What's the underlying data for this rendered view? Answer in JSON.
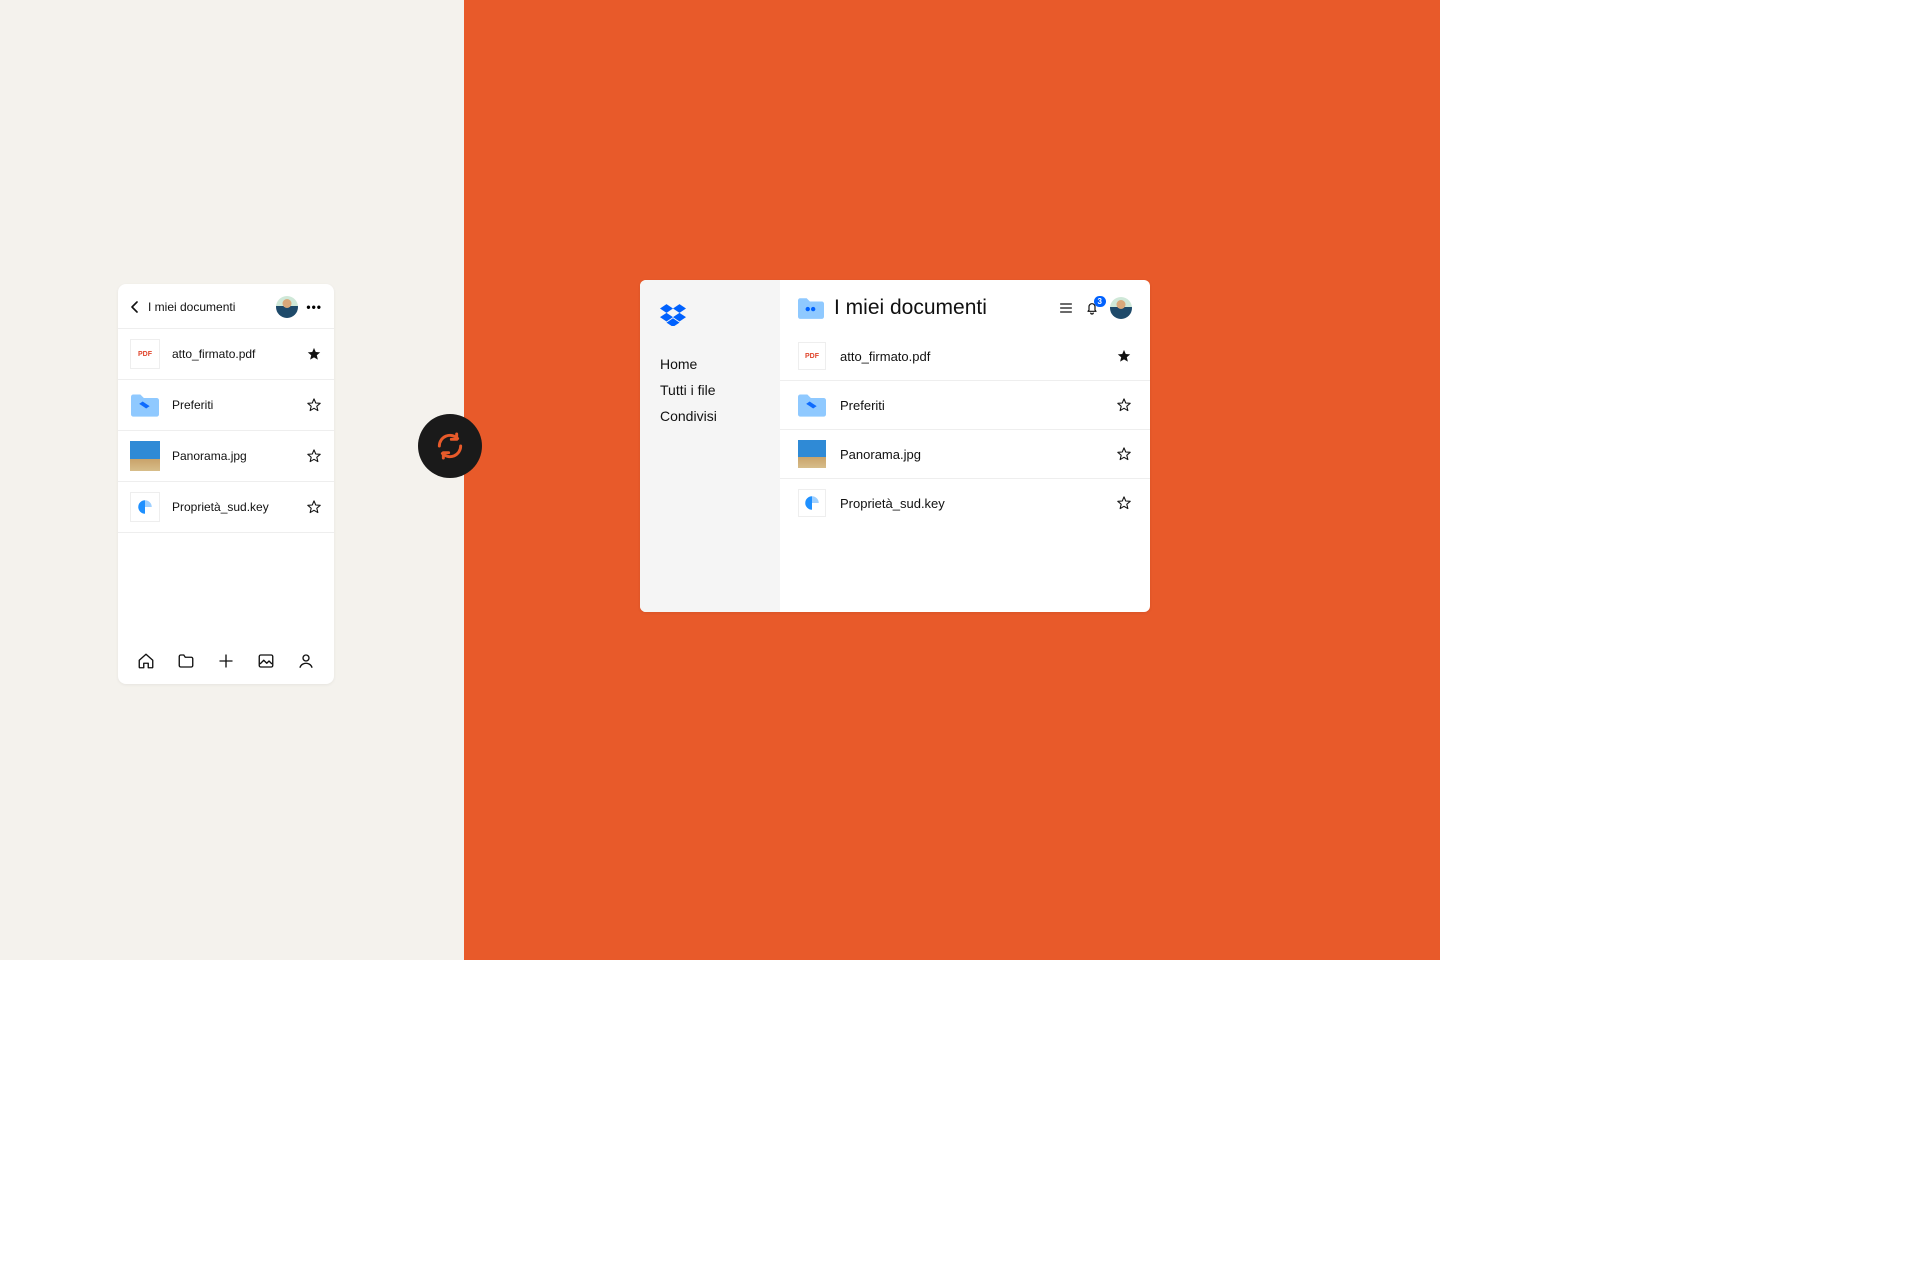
{
  "colors": {
    "left_bg": "#f4f2ed",
    "right_bg": "#e85a2a",
    "accent_blue": "#0061fe"
  },
  "mobile": {
    "back_label": "I miei documenti",
    "files": [
      {
        "name": "atto_firmato.pdf",
        "type": "pdf",
        "starred": true
      },
      {
        "name": "Preferiti",
        "type": "folder",
        "starred": false
      },
      {
        "name": "Panorama.jpg",
        "type": "photo",
        "starred": false
      },
      {
        "name": "Proprietà_sud.key",
        "type": "key",
        "starred": false
      }
    ],
    "bottom_icons": [
      "home-icon",
      "folder-icon",
      "plus-icon",
      "photos-icon",
      "profile-icon"
    ]
  },
  "desktop": {
    "nav": [
      "Home",
      "Tutti i file",
      "Condivisi"
    ],
    "title": "I miei documenti",
    "notification_count": "3",
    "files": [
      {
        "name": "atto_firmato.pdf",
        "type": "pdf",
        "starred": true
      },
      {
        "name": "Preferiti",
        "type": "folder",
        "starred": false
      },
      {
        "name": "Panorama.jpg",
        "type": "photo",
        "starred": false
      },
      {
        "name": "Proprietà_sud.key",
        "type": "key",
        "starred": false
      }
    ]
  }
}
